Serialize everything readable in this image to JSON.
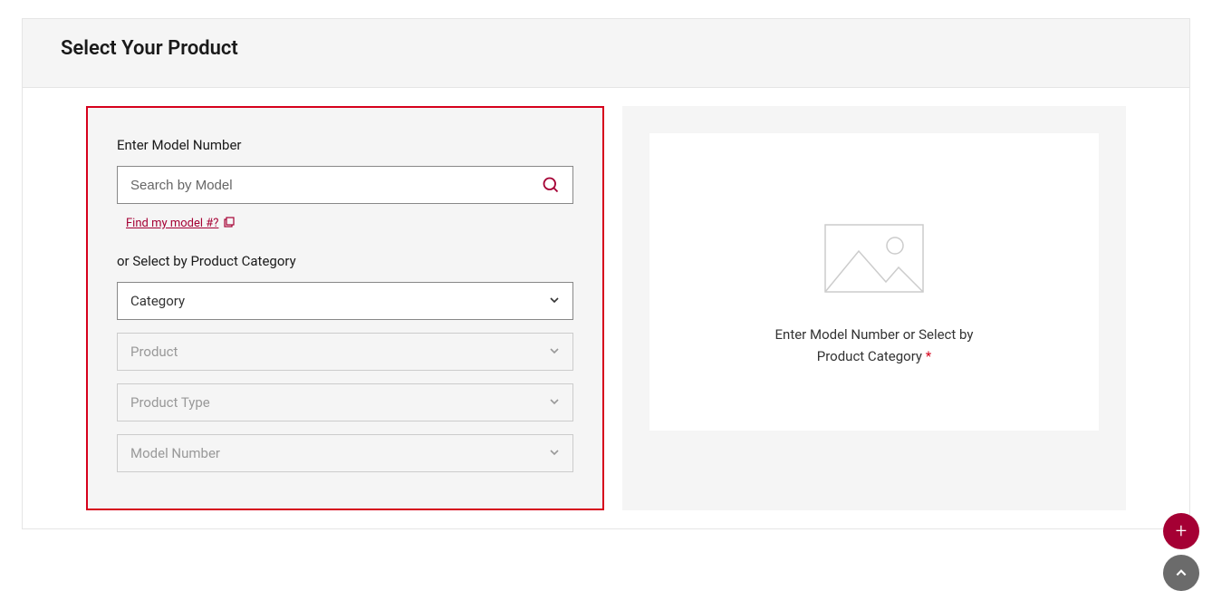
{
  "header": {
    "title": "Select Your Product"
  },
  "form": {
    "modelLabel": "Enter Model Number",
    "searchPlaceholder": "Search by Model",
    "findLinkText": "Find my model #?",
    "categoryLabel": "or Select by Product Category",
    "selects": {
      "category": "Category",
      "product": "Product",
      "productType": "Product Type",
      "modelNumber": "Model Number"
    }
  },
  "preview": {
    "promptLine1": "Enter Model Number or Select by",
    "promptLine2": "Product Category",
    "asterisk": "*"
  },
  "fab": {
    "plus": "+"
  }
}
